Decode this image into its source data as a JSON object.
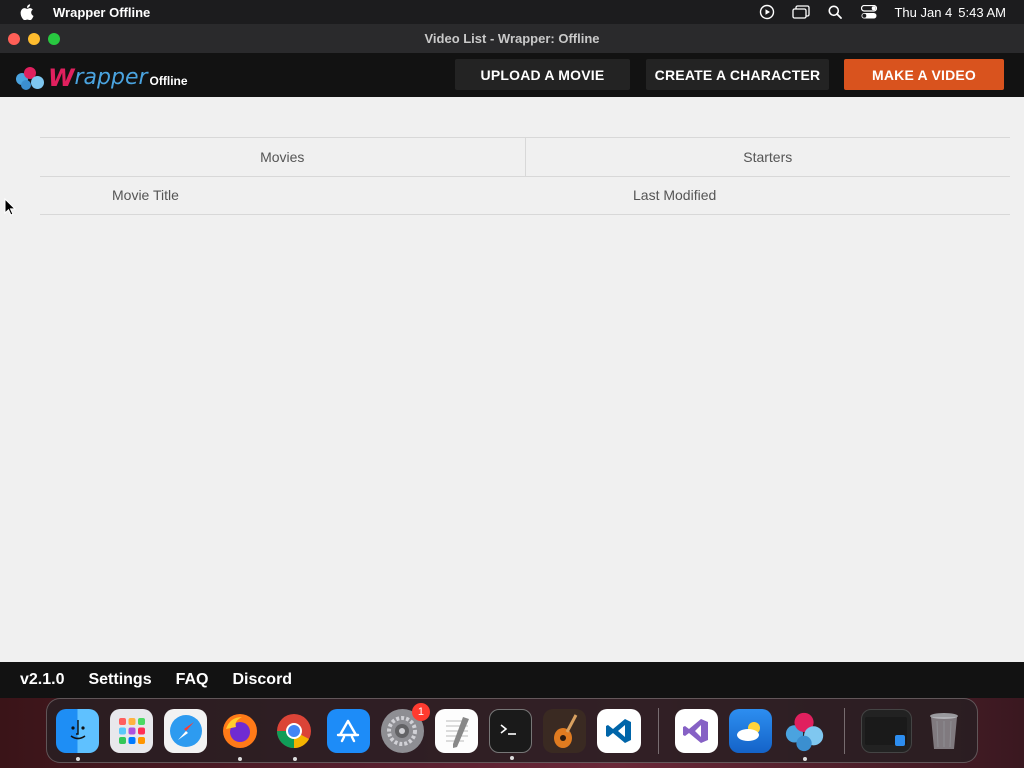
{
  "menubar": {
    "app_name": "Wrapper Offline",
    "date": "Thu Jan 4",
    "time": "5:43 AM"
  },
  "window": {
    "title": "Video List - Wrapper: Offline"
  },
  "header": {
    "logo_letter": "W",
    "logo_rest": "rapper",
    "logo_suffix": "Offline",
    "buttons": {
      "upload": "UPLOAD A MOVIE",
      "create": "CREATE A CHARACTER",
      "make": "MAKE A VIDEO"
    },
    "accent_color": "#d9531e"
  },
  "main": {
    "tabs": [
      {
        "label": "Movies"
      },
      {
        "label": "Starters"
      }
    ],
    "columns": {
      "title": "Movie Title",
      "modified": "Last Modified"
    }
  },
  "footer": {
    "version": "v2.1.0",
    "settings": "Settings",
    "faq": "FAQ",
    "discord": "Discord"
  },
  "dock": {
    "settings_badge": "1",
    "apps": [
      "finder-icon",
      "launchpad-icon",
      "safari-icon",
      "firefox-icon",
      "chrome-icon",
      "app-store-icon",
      "system-settings-icon",
      "textedit-icon",
      "terminal-icon",
      "garageband-icon",
      "vscode-icon",
      "visual-studio-icon",
      "weather-icon",
      "wrapper-offline-icon",
      "downloads-stack-icon",
      "trash-icon"
    ]
  }
}
